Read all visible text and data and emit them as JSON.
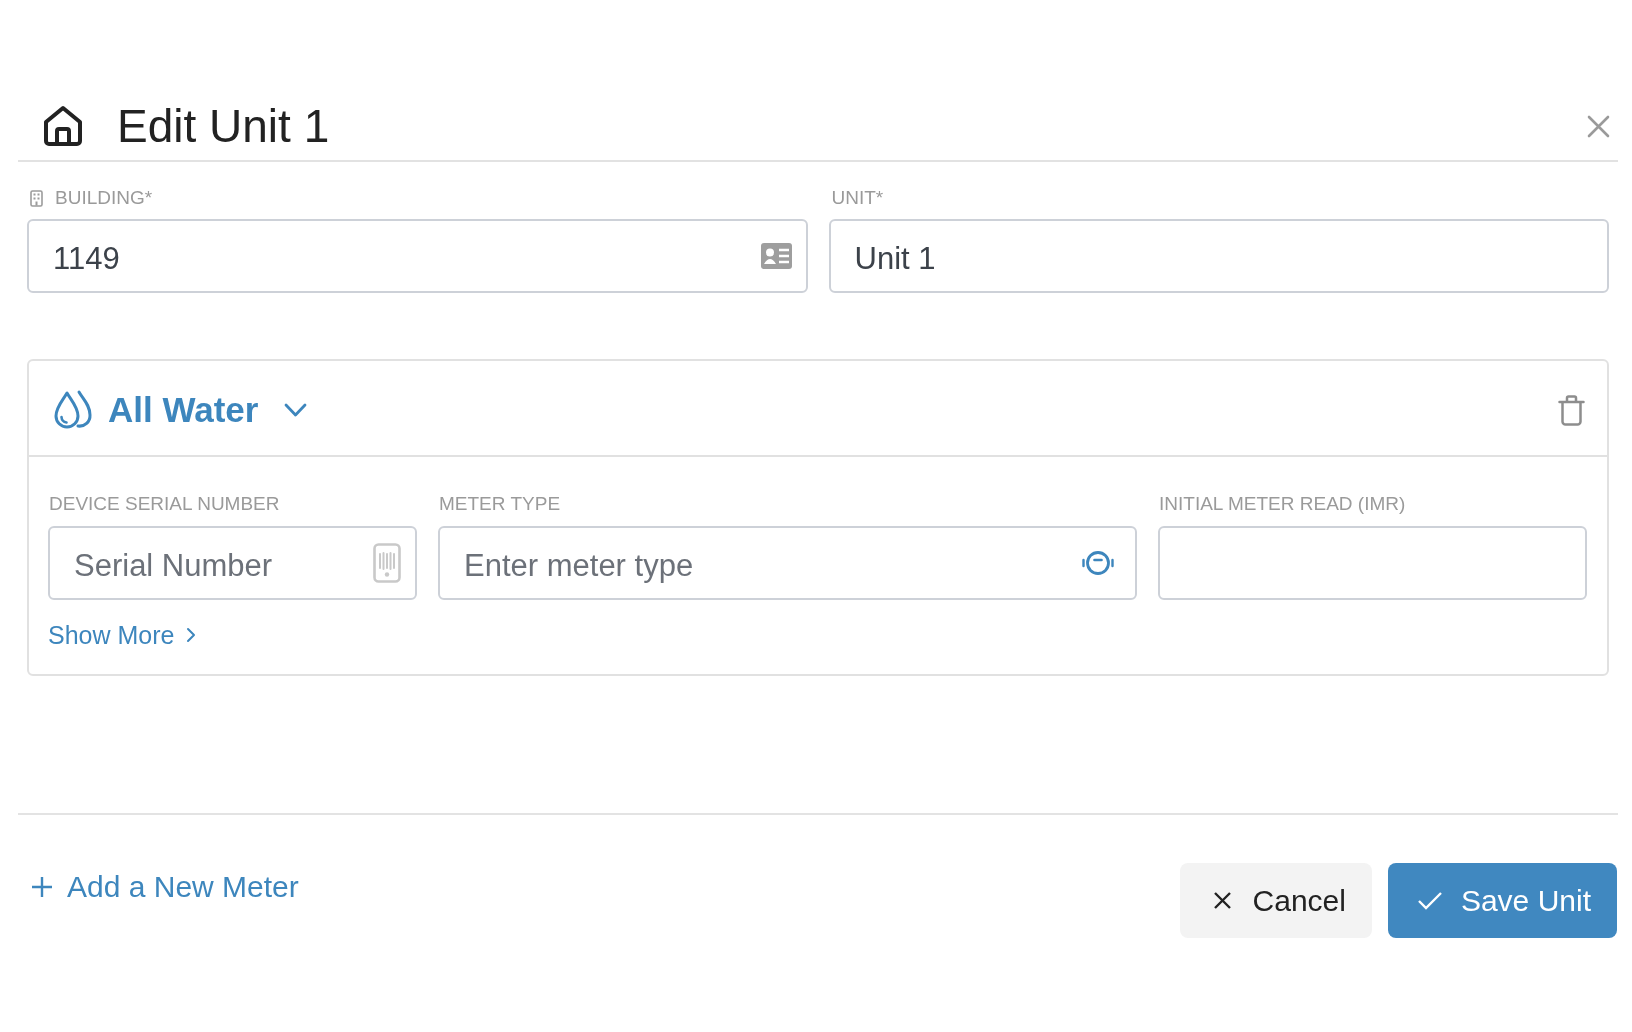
{
  "dialog": {
    "title": "Edit Unit 1"
  },
  "unit_fields": [
    {
      "kind": "building",
      "label": "BUILDING*",
      "value": "1149"
    },
    {
      "kind": "text",
      "label": "UNIT*",
      "value": "Unit 1"
    }
  ],
  "meter": {
    "utility": "All Water",
    "fields": [
      {
        "kind": "serial",
        "label": "DEVICE SERIAL NUMBER",
        "placeholder": "Serial Number"
      },
      {
        "kind": "type",
        "label": "METER TYPE",
        "placeholder": "Enter meter type"
      },
      {
        "kind": "plain",
        "label": "INITIAL METER READ (IMR)"
      }
    ],
    "show_more": "Show More"
  },
  "footer": {
    "add_meter": "Add a New Meter",
    "buttons": [
      {
        "kind": "cancel",
        "label": "Cancel"
      },
      {
        "kind": "save",
        "label": "Save Unit"
      }
    ]
  }
}
